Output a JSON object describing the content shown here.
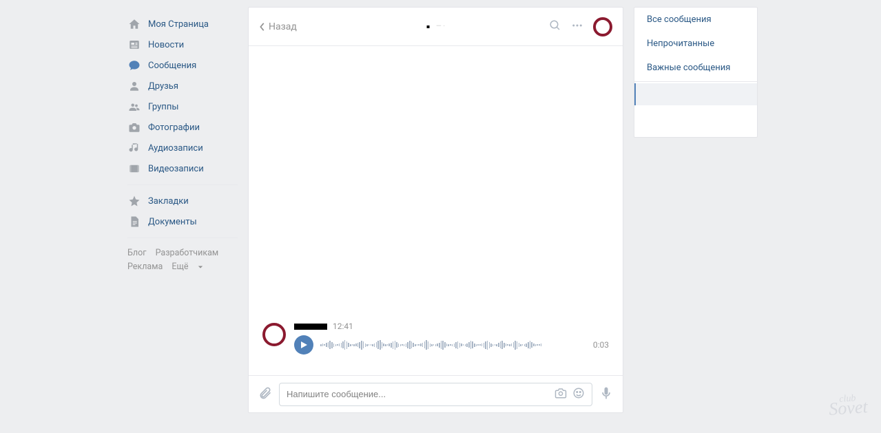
{
  "nav": {
    "my_page": "Моя Страница",
    "news": "Новости",
    "messages": "Сообщения",
    "friends": "Друзья",
    "groups": "Группы",
    "photos": "Фотографии",
    "audio": "Аудиозаписи",
    "video": "Видеозаписи",
    "bookmarks": "Закладки",
    "documents": "Документы"
  },
  "footer": {
    "blog": "Блог",
    "devs": "Разработчикам",
    "ads": "Реклама",
    "more": "Ещё"
  },
  "chat": {
    "back_label": "Назад",
    "message_time": "12:41",
    "audio_duration": "0:03",
    "input_placeholder": "Напишите сообщение..."
  },
  "filters": {
    "all": "Все сообщения",
    "unread": "Непрочитанные",
    "important": "Важные сообщения"
  },
  "watermark": {
    "top": "club",
    "main": "Sovet"
  }
}
